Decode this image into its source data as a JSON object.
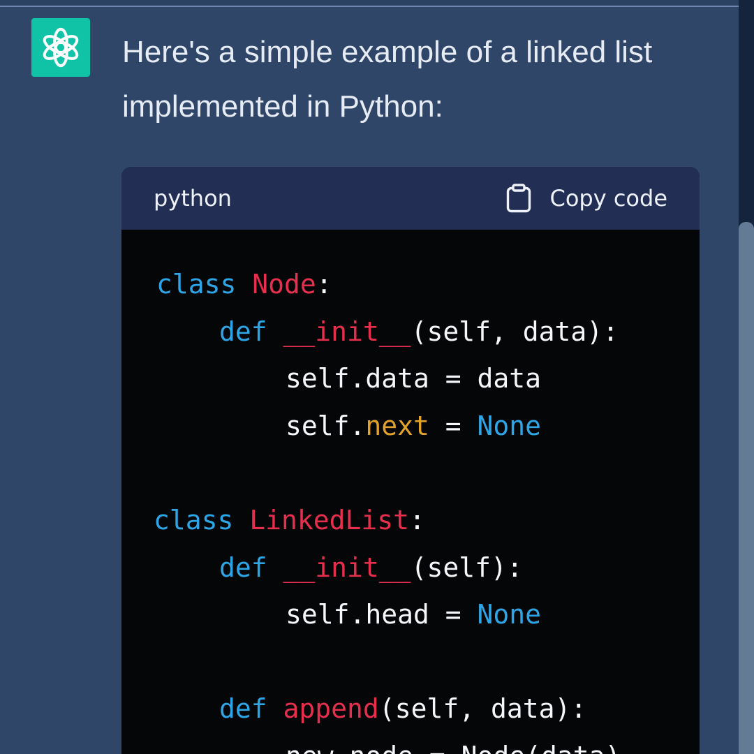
{
  "message": {
    "line1": "Here's a simple example of a linked list",
    "line2": "implemented in Python:"
  },
  "code_block": {
    "language": "python",
    "copy_label": "Copy code",
    "lines": [
      {
        "tokens": [
          {
            "t": "kw",
            "v": "class"
          },
          {
            "t": "pl",
            "v": " "
          },
          {
            "t": "nm",
            "v": "Node"
          },
          {
            "t": "pl",
            "v": ":"
          }
        ]
      },
      {
        "tokens": [
          {
            "t": "kw",
            "v": "def"
          },
          {
            "t": "pl",
            "v": " "
          },
          {
            "t": "nm",
            "v": "__init__"
          },
          {
            "t": "pl",
            "v": "(self, data):"
          }
        ]
      },
      {
        "tokens": [
          {
            "t": "pl",
            "v": "self.data = data"
          }
        ]
      },
      {
        "tokens": [
          {
            "t": "pl",
            "v": "self."
          },
          {
            "t": "at",
            "v": "next"
          },
          {
            "t": "pl",
            "v": " = "
          },
          {
            "t": "cn",
            "v": "None"
          }
        ]
      },
      {
        "tokens": [
          {
            "t": "kw",
            "v": "class"
          },
          {
            "t": "pl",
            "v": " "
          },
          {
            "t": "nm",
            "v": "LinkedList"
          },
          {
            "t": "pl",
            "v": ":"
          }
        ]
      },
      {
        "tokens": [
          {
            "t": "kw",
            "v": "def"
          },
          {
            "t": "pl",
            "v": " "
          },
          {
            "t": "nm",
            "v": "__init__"
          },
          {
            "t": "pl",
            "v": "(self):"
          }
        ]
      },
      {
        "tokens": [
          {
            "t": "pl",
            "v": "self.head = "
          },
          {
            "t": "cn",
            "v": "None"
          }
        ]
      },
      {
        "tokens": [
          {
            "t": "kw",
            "v": "def"
          },
          {
            "t": "pl",
            "v": " "
          },
          {
            "t": "nm",
            "v": "append"
          },
          {
            "t": "pl",
            "v": "(self, data):"
          }
        ]
      },
      {
        "tokens": [
          {
            "t": "pl",
            "v": "new_node = Node(data)"
          }
        ]
      }
    ]
  },
  "icons": {
    "avatar": "openai-logo-icon",
    "copy": "clipboard-icon"
  },
  "colors": {
    "background": "#2f4668",
    "avatar": "#10c3a6",
    "code_header": "#222e53",
    "code_body": "#040608",
    "keyword": "#2ea5e6",
    "name": "#e62f4d",
    "attribute": "#e2a22a"
  }
}
